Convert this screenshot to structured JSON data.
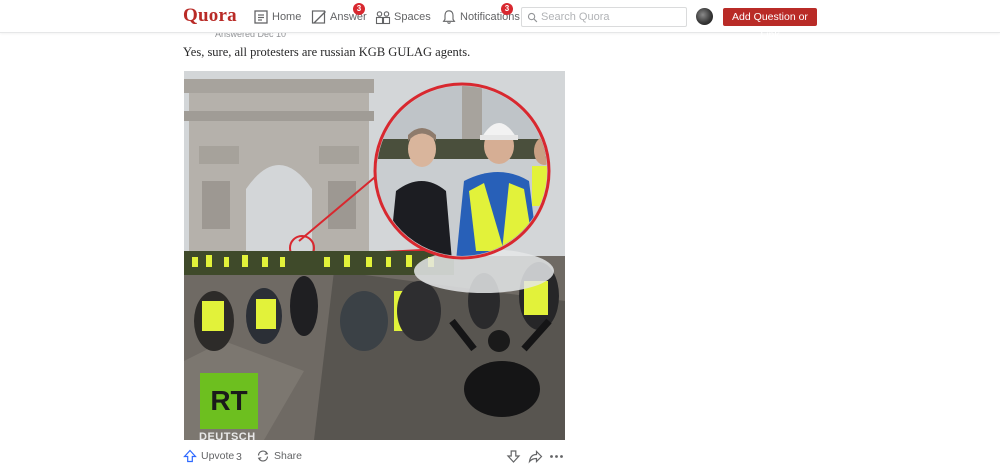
{
  "header": {
    "logo": "Quora",
    "nav": {
      "home": "Home",
      "answer": "Answer",
      "answer_badge": "3",
      "spaces": "Spaces",
      "notifications": "Notifications",
      "notifications_badge": "3"
    },
    "search_placeholder": "Search Quora",
    "add_button": "Add Question or Link"
  },
  "answer": {
    "meta": "Answered Dec 10",
    "text": "Yes, sure, all protesters are russian KGB GULAG agents.",
    "image": {
      "logo_text": "RT",
      "logo_subtext": "DEUTSCH"
    }
  },
  "actions": {
    "upvote_label": "Upvote",
    "upvote_count": "3",
    "share_label": "Share"
  },
  "colors": {
    "brand": "#b92b27",
    "badge": "#d8282f",
    "vest": "#e2f23a",
    "rt_green": "#6dbf1f"
  }
}
